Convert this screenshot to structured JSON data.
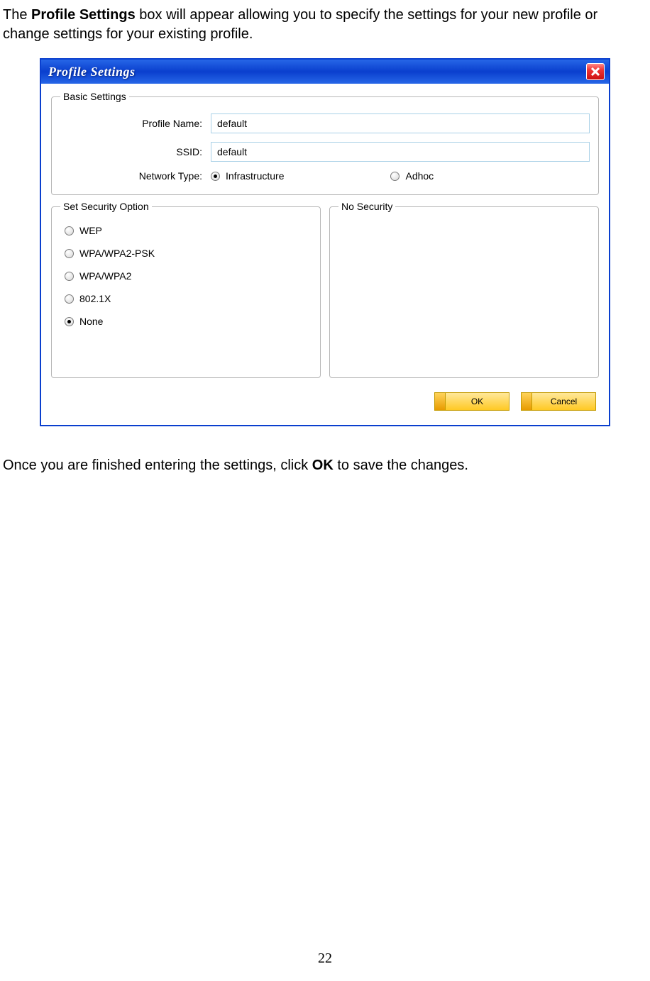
{
  "intro": {
    "prefix": "The ",
    "bold": "Profile Settings",
    "suffix": " box will appear allowing you to specify the settings for your new profile or change settings for your existing profile."
  },
  "dialog": {
    "title": "Profile Settings",
    "basic": {
      "legend": "Basic Settings",
      "profile_name_label": "Profile Name:",
      "profile_name_value": "default",
      "ssid_label": "SSID:",
      "ssid_value": "default",
      "network_type_label": "Network Type:",
      "network_type": {
        "infrastructure": "Infrastructure",
        "adhoc": "Adhoc",
        "selected": "infrastructure"
      }
    },
    "security": {
      "legend": "Set Security Option",
      "options": [
        "WEP",
        "WPA/WPA2-PSK",
        "WPA/WPA2",
        "802.1X",
        "None"
      ],
      "selected": "None"
    },
    "no_security": {
      "legend": "No Security"
    },
    "buttons": {
      "ok": "OK",
      "cancel": "Cancel"
    }
  },
  "after": {
    "prefix": "Once you are finished entering the settings, click ",
    "bold": "OK",
    "suffix": " to save the changes."
  },
  "page_number": "22"
}
